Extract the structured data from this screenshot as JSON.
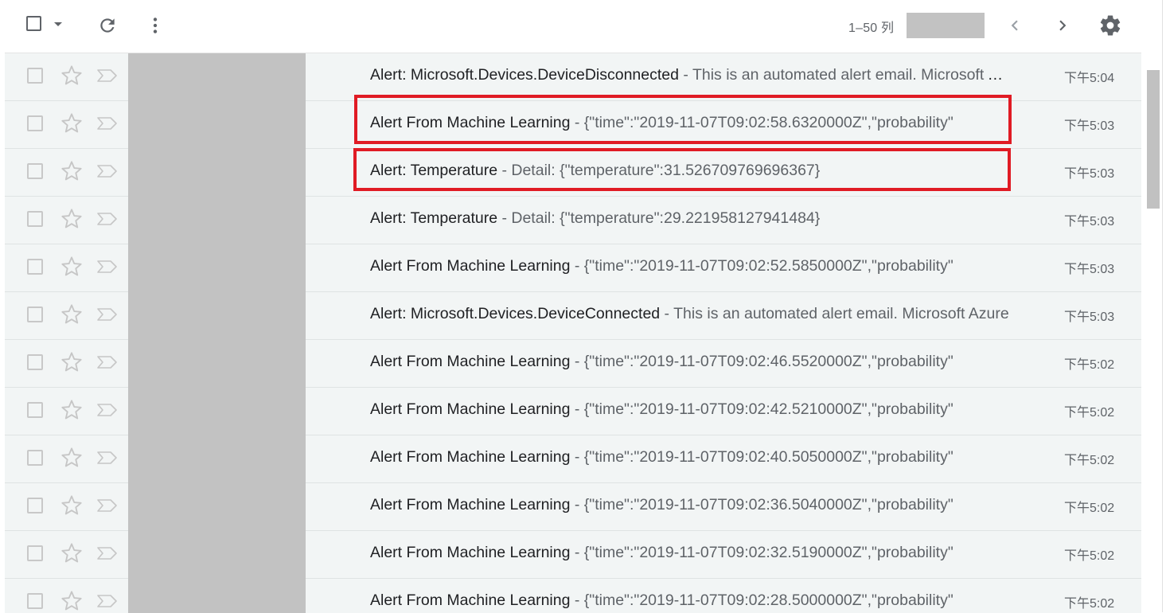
{
  "toolbar": {
    "select_all_icon": "checkbox-icon",
    "select_menu_icon": "caret-down-icon",
    "refresh_icon": "refresh-icon",
    "more_icon": "more-vert-icon",
    "pagination": "1–50 列",
    "prev_icon": "chevron-left-icon",
    "next_icon": "chevron-right-icon",
    "settings_icon": "gear-icon"
  },
  "colors": {
    "row_background": "#f2f5f5",
    "highlight_border": "#e01b24",
    "redaction": "#c2c2c2"
  },
  "emails": [
    {
      "subject": "Alert: Microsoft.Devices.DeviceDisconnected",
      "snippet": " - This is an automated alert email. Microsoft Azure",
      "time": "下午5:04",
      "highlighted": false
    },
    {
      "subject": "Alert From Machine Learning",
      "snippet": " - {\"time\":\"2019-11-07T09:02:58.6320000Z\",\"probability\"",
      "time": "下午5:03",
      "highlighted": true
    },
    {
      "subject": "Alert: Temperature",
      "snippet": " - Detail: {\"temperature\":31.526709769696367}",
      "time": "下午5:03",
      "highlighted": true
    },
    {
      "subject": "Alert: Temperature",
      "snippet": " - Detail: {\"temperature\":29.221958127941484}",
      "time": "下午5:03",
      "highlighted": false
    },
    {
      "subject": "Alert From Machine Learning",
      "snippet": " - {\"time\":\"2019-11-07T09:02:52.5850000Z\",\"probability\"",
      "time": "下午5:03",
      "highlighted": false
    },
    {
      "subject": "Alert: Microsoft.Devices.DeviceConnected",
      "snippet": " - This is an automated alert email. Microsoft Azure",
      "time": "下午5:03",
      "highlighted": false
    },
    {
      "subject": "Alert From Machine Learning",
      "snippet": " - {\"time\":\"2019-11-07T09:02:46.5520000Z\",\"probability\"",
      "time": "下午5:02",
      "highlighted": false
    },
    {
      "subject": "Alert From Machine Learning",
      "snippet": " - {\"time\":\"2019-11-07T09:02:42.5210000Z\",\"probability\"",
      "time": "下午5:02",
      "highlighted": false
    },
    {
      "subject": "Alert From Machine Learning",
      "snippet": " - {\"time\":\"2019-11-07T09:02:40.5050000Z\",\"probability\"",
      "time": "下午5:02",
      "highlighted": false
    },
    {
      "subject": "Alert From Machine Learning",
      "snippet": " - {\"time\":\"2019-11-07T09:02:36.5040000Z\",\"probability\"",
      "time": "下午5:02",
      "highlighted": false
    },
    {
      "subject": "Alert From Machine Learning",
      "snippet": " - {\"time\":\"2019-11-07T09:02:32.5190000Z\",\"probability\"",
      "time": "下午5:02",
      "highlighted": false
    },
    {
      "subject": "Alert From Machine Learning",
      "snippet": " - {\"time\":\"2019-11-07T09:02:28.5000000Z\",\"probability\"",
      "time": "下午5:02",
      "highlighted": false
    }
  ]
}
